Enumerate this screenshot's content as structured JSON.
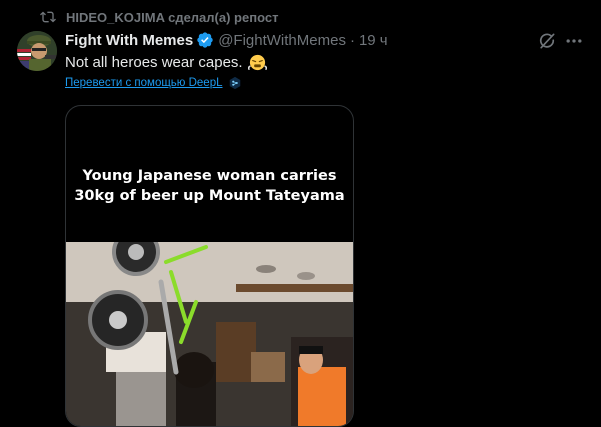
{
  "repost": {
    "icon": "repost-icon",
    "text": "HIDEO_KOJIMA сделал(а) репост"
  },
  "tweet": {
    "display_name": "Fight With Memes",
    "verified_icon": "verified-badge-icon",
    "handle": "@FightWithMemes",
    "separator": "·",
    "time": "19 ч",
    "text": "Not all heroes wear capes.",
    "emoji": "face-with-steam-emoji",
    "translate_link": "Перевести с помощью DeepL",
    "translate_icon": "deepl-icon",
    "media_caption_line1": "Young Japanese woman carries",
    "media_caption_line2": "30kg of beer up Mount Tateyama"
  },
  "actions": {
    "grok_icon": "grok-icon",
    "more_icon": "more-options-icon"
  },
  "colors": {
    "background": "#000000",
    "text": "#e7e9ea",
    "muted": "#71767b",
    "link": "#1d9bf0",
    "verified": "#1d9bf0"
  }
}
